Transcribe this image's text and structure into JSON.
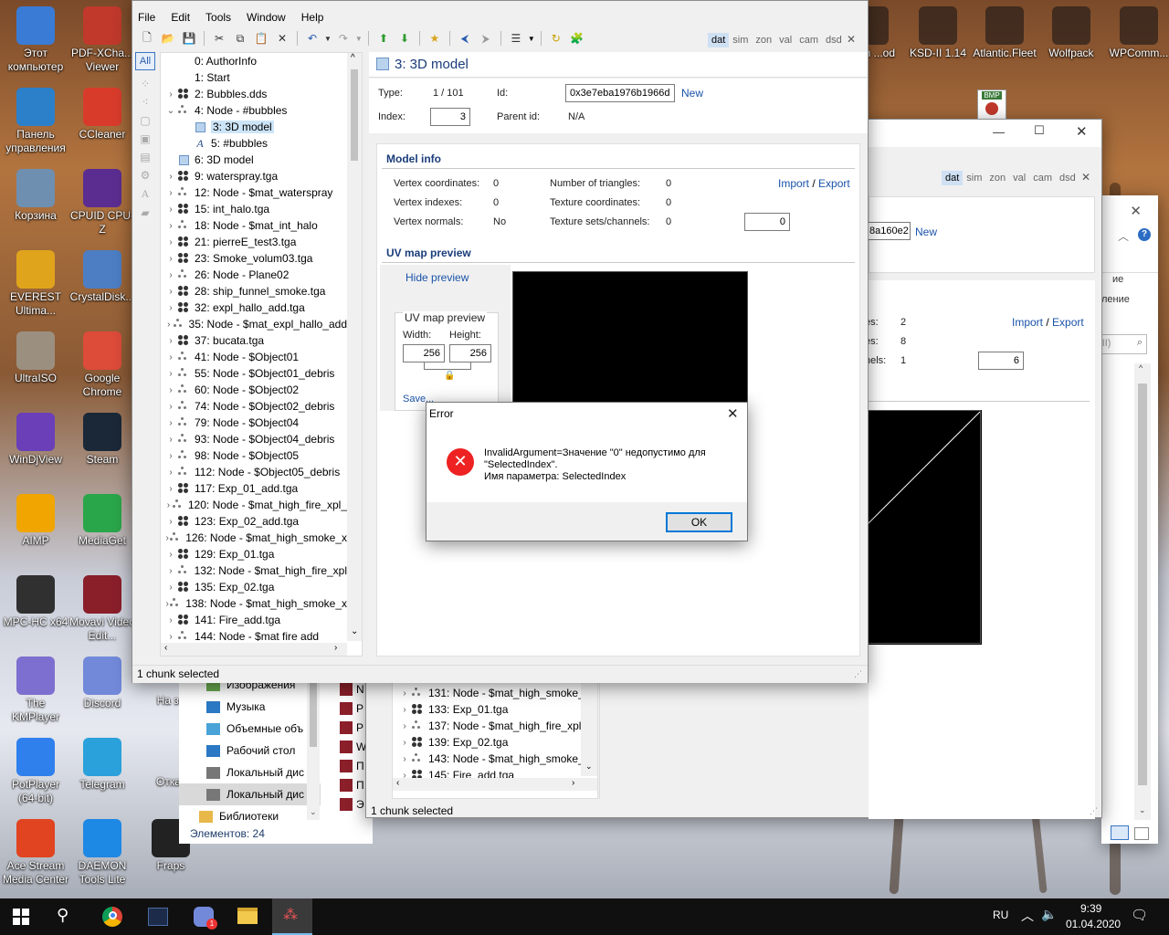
{
  "desktop_icons": [
    {
      "label": "Этот компьютер",
      "icon": "computer-icon",
      "color": "#3a7bd5"
    },
    {
      "label": "PDF-XCha... Viewer",
      "icon": "pdf-icon",
      "color": "#c0392b"
    },
    {
      "label": "Панель управления",
      "icon": "control-panel-icon",
      "color": "#2c7fc9"
    },
    {
      "label": "CCleaner",
      "icon": "ccleaner-icon",
      "color": "#d93b2b"
    },
    {
      "label": "Корзина",
      "icon": "recycle-bin-icon",
      "color": "#6e8fb0"
    },
    {
      "label": "CPUID CPU-Z",
      "icon": "cpuz-icon",
      "color": "#5b2d91"
    },
    {
      "label": "EVEREST Ultima...",
      "icon": "everest-icon",
      "color": "#e0a41c"
    },
    {
      "label": "CrystalDisk...",
      "icon": "crystaldisk-icon",
      "color": "#4d7ec4"
    },
    {
      "label": "UltraISO",
      "icon": "ultraiso-icon",
      "color": "#9b8f80"
    },
    {
      "label": "Google Chrome",
      "icon": "chrome-icon",
      "color": "#dd4b39"
    },
    {
      "label": "WinDjView",
      "icon": "windjview-icon",
      "color": "#6a3fb8"
    },
    {
      "label": "Steam",
      "icon": "steam-icon",
      "color": "#1b2838"
    },
    {
      "label": "AIMP",
      "icon": "aimp-icon",
      "color": "#f0a500"
    },
    {
      "label": "MediaGet",
      "icon": "mediaget-icon",
      "color": "#2aa64a"
    },
    {
      "label": "MPC-HC x64",
      "icon": "mpchc-icon",
      "color": "#303030"
    },
    {
      "label": "Movavi Video Edit...",
      "icon": "movavi-icon",
      "color": "#8a1f2a"
    },
    {
      "label": "The KMPlayer",
      "icon": "kmplayer-icon",
      "color": "#7d6fcf"
    },
    {
      "label": "Discord",
      "icon": "discord-icon",
      "color": "#7289da"
    },
    {
      "label": "PotPlayer (64-bit)",
      "icon": "potplayer-icon",
      "color": "#2f80ed"
    },
    {
      "label": "Telegram",
      "icon": "telegram-icon",
      "color": "#2aa1da"
    },
    {
      "label": "Ace Stream Media Center",
      "icon": "acestream-icon",
      "color": "#e04420"
    },
    {
      "label": "DAEMON Tools Lite",
      "icon": "daemon-icon",
      "color": "#1e88e5"
    },
    {
      "label": "Fraps",
      "icon": "fraps-icon",
      "color": "#222222"
    }
  ],
  "desktop_top_icons": [
    {
      "label": "...e in ...od",
      "icon": "game-icon"
    },
    {
      "label": "KSD-II 1.14",
      "icon": "ksd-icon"
    },
    {
      "label": "Atlantic.Fleet",
      "icon": "ship-icon"
    },
    {
      "label": "Wolfpack",
      "icon": "wolf-icon"
    },
    {
      "label": "WPComm...",
      "icon": "wpc-icon"
    }
  ],
  "desktop_misc": {
    "bmp_label": "BMP",
    "na_za": "На за",
    "otkat": "Откат"
  },
  "main_window": {
    "menu": [
      "File",
      "Edit",
      "Tools",
      "Window",
      "Help"
    ],
    "tabs": [
      "dat",
      "sim",
      "zon",
      "val",
      "cam",
      "dsd"
    ],
    "active_tab": "dat",
    "filter_label": "All",
    "tree": [
      {
        "label": "0: AuthorInfo",
        "icon": "none",
        "exp": ""
      },
      {
        "label": "1: Start",
        "icon": "none",
        "exp": ""
      },
      {
        "label": "2: Bubbles.dds",
        "icon": "dots",
        "exp": "›"
      },
      {
        "label": "4: Node - #bubbles",
        "icon": "dots-small",
        "exp": "⌄"
      },
      {
        "label": "3: 3D model",
        "icon": "cube",
        "exp": "",
        "indent": 1,
        "selected": true
      },
      {
        "label": "5: #bubbles",
        "icon": "A",
        "exp": "",
        "indent": 1
      },
      {
        "label": "6: 3D model",
        "icon": "cube",
        "exp": ""
      },
      {
        "label": "9: waterspray.tga",
        "icon": "dots",
        "exp": "›"
      },
      {
        "label": "12: Node - $mat_waterspray",
        "icon": "dots-small",
        "exp": "›"
      },
      {
        "label": "15: int_halo.tga",
        "icon": "dots",
        "exp": "›"
      },
      {
        "label": "18: Node - $mat_int_halo",
        "icon": "dots-small",
        "exp": "›"
      },
      {
        "label": "21: pierreE_test3.tga",
        "icon": "dots",
        "exp": "›"
      },
      {
        "label": "23: Smoke_volum03.tga",
        "icon": "dots",
        "exp": "›"
      },
      {
        "label": "26: Node - Plane02",
        "icon": "dots-small",
        "exp": "›"
      },
      {
        "label": "28: ship_funnel_smoke.tga",
        "icon": "dots",
        "exp": "›"
      },
      {
        "label": "32: expl_hallo_add.tga",
        "icon": "dots",
        "exp": "›"
      },
      {
        "label": "35: Node - $mat_expl_hallo_add",
        "icon": "dots-small",
        "exp": "›"
      },
      {
        "label": "37: bucata.tga",
        "icon": "dots",
        "exp": "›"
      },
      {
        "label": "41: Node - $Object01",
        "icon": "dots-small",
        "exp": "›"
      },
      {
        "label": "55: Node - $Object01_debris",
        "icon": "dots-small",
        "exp": "›"
      },
      {
        "label": "60: Node - $Object02",
        "icon": "dots-small",
        "exp": "›"
      },
      {
        "label": "74: Node - $Object02_debris",
        "icon": "dots-small",
        "exp": "›"
      },
      {
        "label": "79: Node - $Object04",
        "icon": "dots-small",
        "exp": "›"
      },
      {
        "label": "93: Node - $Object04_debris",
        "icon": "dots-small",
        "exp": "›"
      },
      {
        "label": "98: Node - $Object05",
        "icon": "dots-small",
        "exp": "›"
      },
      {
        "label": "112: Node - $Object05_debris",
        "icon": "dots-small",
        "exp": "›"
      },
      {
        "label": "117: Exp_01_add.tga",
        "icon": "dots",
        "exp": "›"
      },
      {
        "label": "120: Node - $mat_high_fire_xpl_",
        "icon": "dots-small",
        "exp": "›"
      },
      {
        "label": "123: Exp_02_add.tga",
        "icon": "dots",
        "exp": "›"
      },
      {
        "label": "126: Node - $mat_high_smoke_x",
        "icon": "dots-small",
        "exp": "›"
      },
      {
        "label": "129: Exp_01.tga",
        "icon": "dots",
        "exp": "›"
      },
      {
        "label": "132: Node - $mat_high_fire_xpl",
        "icon": "dots-small",
        "exp": "›"
      },
      {
        "label": "135: Exp_02.tga",
        "icon": "dots",
        "exp": "›"
      },
      {
        "label": "138: Node - $mat_high_smoke_x",
        "icon": "dots-small",
        "exp": "›"
      },
      {
        "label": "141: Fire_add.tga",
        "icon": "dots",
        "exp": "›"
      },
      {
        "label": "144: Node - $mat fire add",
        "icon": "dots-small",
        "exp": "›"
      }
    ],
    "status": "1 chunk selected",
    "detail": {
      "title": "3: 3D model",
      "type_label": "Type:",
      "type_value": "1 / 101",
      "id_label": "Id:",
      "id_value": "0x3e7eba1976b1966d",
      "new_link": "New",
      "index_label": "Index:",
      "index_value": "3",
      "parent_label": "Parent id:",
      "parent_value": "N/A",
      "model_info": "Model info",
      "vc_label": "Vertex coordinates:",
      "vc_value": "0",
      "vi_label": "Vertex indexes:",
      "vi_value": "0",
      "vn_label": "Vertex normals:",
      "vn_value": "No",
      "tri_label": "Number of triangles:",
      "tri_value": "0",
      "tc_label": "Texture coordinates:",
      "tc_value": "0",
      "ts_label": "Texture sets/channels:",
      "ts_value": "0",
      "ts_field": "0",
      "import": "Import",
      "slash": "/",
      "export": "Export",
      "uv_section": "UV map preview",
      "hide_preview": "Hide preview",
      "uv_group": "UV map preview",
      "width_label": "Width:",
      "width_value": "256",
      "height_label": "Height:",
      "height_value": "256",
      "save": "Save..."
    }
  },
  "back_window": {
    "tabs": [
      "dat",
      "sim",
      "zon",
      "val",
      "cam",
      "dsd"
    ],
    "active_tab": "dat",
    "id_partial": "8a160e2",
    "new_link": "New",
    "rows": [
      {
        "label": "es:",
        "value": "2"
      },
      {
        "label": "es:",
        "value": "8"
      },
      {
        "label": "nels:",
        "value": "1"
      }
    ],
    "field": "6",
    "import": "Import",
    "slash": "/",
    "export": "Export",
    "tree": [
      {
        "label": "131: Node - $mat_high_smoke_x",
        "icon": "dots-small"
      },
      {
        "label": "133: Exp_01.tga",
        "icon": "dots"
      },
      {
        "label": "137: Node - $mat_high_fire_xpl",
        "icon": "dots-small"
      },
      {
        "label": "139: Exp_02.tga",
        "icon": "dots"
      },
      {
        "label": "143: Node - $mat_high_smoke_x",
        "icon": "dots-small"
      },
      {
        "label": "145: Fire_add.tga",
        "icon": "dots"
      }
    ],
    "status": "1 chunk selected"
  },
  "settings_window": {
    "text1": "ие",
    "text2": "ление",
    "search_placeholder": "-II)"
  },
  "explorer": {
    "items": [
      {
        "label": "Изображения",
        "icon": "pictures-icon"
      },
      {
        "label": "Музыка",
        "icon": "music-icon"
      },
      {
        "label": "Объемные объ",
        "icon": "3d-objects-icon"
      },
      {
        "label": "Рабочий стол",
        "icon": "desktop-folder-icon"
      },
      {
        "label": "Локальный дис",
        "icon": "drive-icon"
      },
      {
        "label": "Локальный дис",
        "icon": "drive-icon",
        "selected": true
      },
      {
        "label": "Библиотеки",
        "icon": "library-icon"
      }
    ],
    "file_letters": [
      "N",
      "P",
      "P",
      "W",
      "П",
      "П",
      "Э"
    ],
    "status": "Элементов: 24"
  },
  "dialog": {
    "title": "Error",
    "message_line1": "InvalidArgument=Значение \"0\" недопустимо для",
    "message_line2": "\"SelectedIndex\".",
    "message_line3": "Имя параметра: SelectedIndex",
    "ok": "OK"
  },
  "taskbar": {
    "lang": "RU",
    "time": "9:39",
    "date": "01.04.2020",
    "discord_badge": "1"
  }
}
